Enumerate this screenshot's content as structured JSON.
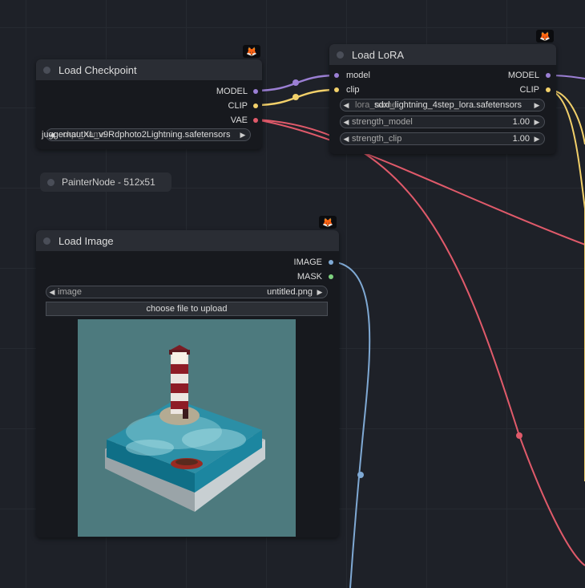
{
  "badge_icon": "fox-icon",
  "load_checkpoint": {
    "title": "Load Checkpoint",
    "outputs": [
      "MODEL",
      "CLIP",
      "VAE"
    ],
    "ckpt_value": "juggernautXL_v9Rdphoto2Lightning.safetensors",
    "ckpt_label": "ckpt_name"
  },
  "painter_node": {
    "title": "PainterNode - 512x51"
  },
  "load_lora": {
    "title": "Load LoRA",
    "inputs": [
      "model",
      "clip"
    ],
    "outputs": [
      "MODEL",
      "CLIP"
    ],
    "widgets": [
      {
        "label": "lora_name",
        "value": "sdxl_lightning_4step_lora.safetensors"
      },
      {
        "label": "strength_model",
        "value": "1.00"
      },
      {
        "label": "strength_clip",
        "value": "1.00"
      }
    ]
  },
  "load_image": {
    "title": "Load Image",
    "outputs": [
      "IMAGE",
      "MASK"
    ],
    "image_widget": {
      "label": "image",
      "value": "untitled.png"
    },
    "upload_button": "choose file to upload"
  },
  "colors": {
    "model": "#9b7fd4",
    "clip": "#f2d06a",
    "vae": "#e05a6a",
    "image": "#7fa9d4",
    "mask": "#7ed17e"
  }
}
